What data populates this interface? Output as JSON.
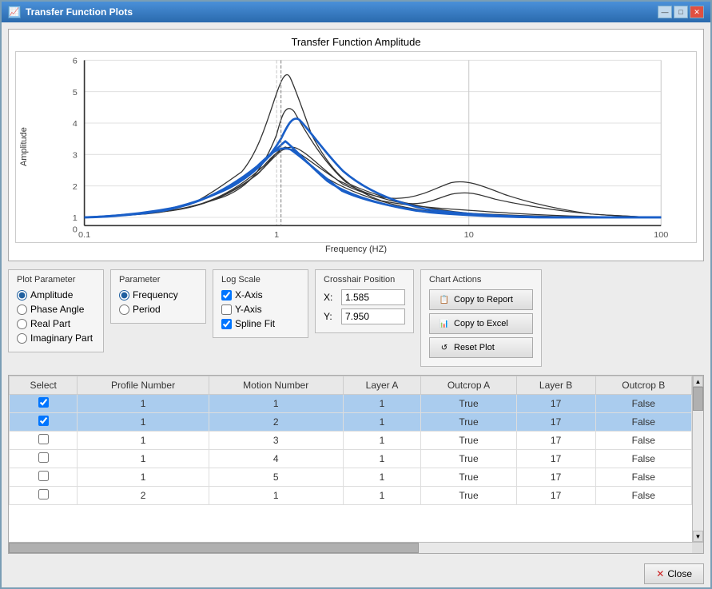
{
  "window": {
    "title": "Transfer Function Plots",
    "titlebar_icon": "📊"
  },
  "titlebar_controls": {
    "minimize_label": "—",
    "restore_label": "□",
    "close_label": "✕"
  },
  "chart": {
    "title": "Transfer Function Amplitude",
    "y_axis_label": "Amplitude",
    "x_axis_label": "Frequency (HZ)",
    "y_ticks": [
      "6",
      "5",
      "4",
      "3",
      "2",
      "1",
      "0"
    ],
    "x_ticks": [
      "0.1",
      "1",
      "10",
      "100"
    ]
  },
  "plot_parameter": {
    "label": "Plot Parameter",
    "options": [
      {
        "id": "amplitude",
        "label": "Amplitude",
        "checked": true
      },
      {
        "id": "phase_angle",
        "label": "Phase Angle",
        "checked": false
      },
      {
        "id": "real_part",
        "label": "Real Part",
        "checked": false
      },
      {
        "id": "imaginary_part",
        "label": "Imaginary Part",
        "checked": false
      }
    ]
  },
  "parameter": {
    "label": "Parameter",
    "options": [
      {
        "id": "frequency",
        "label": "Frequency",
        "checked": true
      },
      {
        "id": "period",
        "label": "Period",
        "checked": false
      }
    ]
  },
  "log_scale": {
    "label": "Log Scale",
    "x_axis": {
      "label": "X-Axis",
      "checked": true
    },
    "y_axis": {
      "label": "Y-Axis",
      "checked": false
    },
    "spline_fit": {
      "label": "Spline Fit",
      "checked": true
    }
  },
  "crosshair": {
    "label": "Crosshair Position",
    "x_label": "X:",
    "x_value": "1.585",
    "y_label": "Y:",
    "y_value": "7.950"
  },
  "chart_actions": {
    "label": "Chart Actions",
    "copy_to_report": "Copy to Report",
    "copy_to_excel": "Copy to Excel",
    "reset_plot": "Reset Plot"
  },
  "table": {
    "columns": [
      "Select",
      "Profile Number",
      "Motion Number",
      "Layer A",
      "Outcrop A",
      "Layer B",
      "Outcrop B"
    ],
    "rows": [
      {
        "select": true,
        "profile_number": 1,
        "motion_number": 1,
        "layer_a": 1,
        "outcrop_a": "True",
        "layer_b": 17,
        "outcrop_b": "False",
        "highlighted": true
      },
      {
        "select": true,
        "profile_number": 1,
        "motion_number": 2,
        "layer_a": 1,
        "outcrop_a": "True",
        "layer_b": 17,
        "outcrop_b": "False",
        "highlighted": true
      },
      {
        "select": false,
        "profile_number": 1,
        "motion_number": 3,
        "layer_a": 1,
        "outcrop_a": "True",
        "layer_b": 17,
        "outcrop_b": "False",
        "highlighted": false
      },
      {
        "select": false,
        "profile_number": 1,
        "motion_number": 4,
        "layer_a": 1,
        "outcrop_a": "True",
        "layer_b": 17,
        "outcrop_b": "False",
        "highlighted": false
      },
      {
        "select": false,
        "profile_number": 1,
        "motion_number": 5,
        "layer_a": 1,
        "outcrop_a": "True",
        "layer_b": 17,
        "outcrop_b": "False",
        "highlighted": false
      },
      {
        "select": false,
        "profile_number": 2,
        "motion_number": 1,
        "layer_a": 1,
        "outcrop_a": "True",
        "layer_b": 17,
        "outcrop_b": "False",
        "highlighted": false
      }
    ]
  },
  "bottom": {
    "close_label": "Close"
  }
}
